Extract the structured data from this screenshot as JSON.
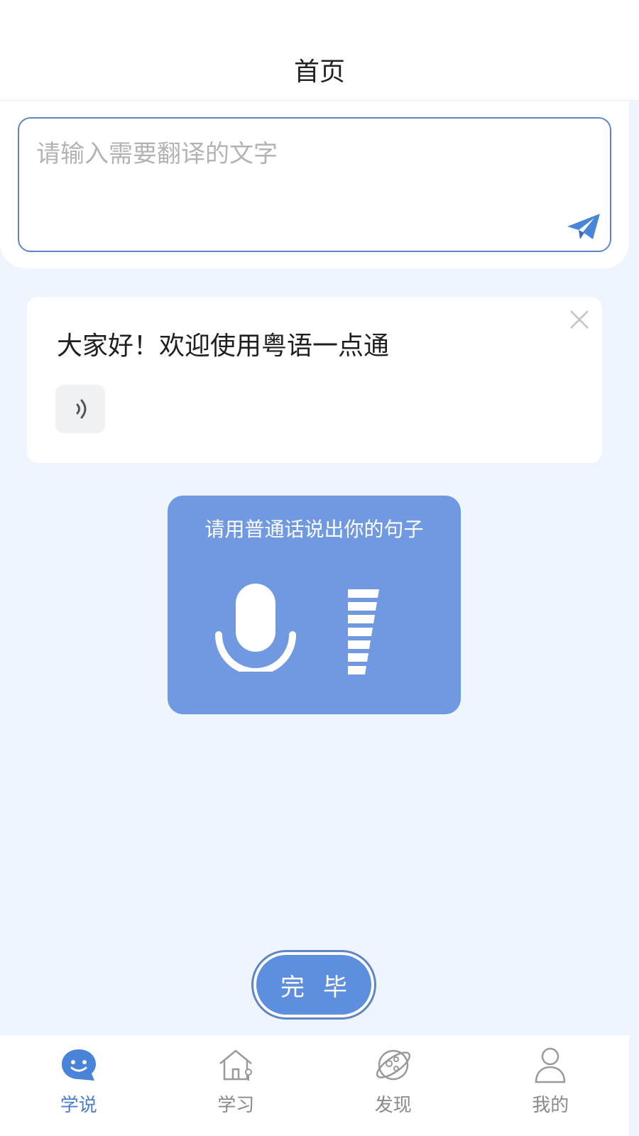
{
  "header": {
    "title": "首页"
  },
  "translate": {
    "placeholder": "请输入需要翻译的文字",
    "value": ""
  },
  "message": {
    "text": "大家好！欢迎使用粤语一点通"
  },
  "voice": {
    "prompt": "请用普通话说出你的句子"
  },
  "done": {
    "label": "完毕"
  },
  "tabs": [
    {
      "label": "学说",
      "icon": "chat-smile-icon",
      "active": true
    },
    {
      "label": "学习",
      "icon": "house-icon",
      "active": false
    },
    {
      "label": "发现",
      "icon": "planet-icon",
      "active": false
    },
    {
      "label": "我的",
      "icon": "person-icon",
      "active": false
    }
  ],
  "colors": {
    "accent": "#5e8fde",
    "border": "#5e86c6",
    "voice_panel": "#7099e2",
    "background": "#eef5fe"
  }
}
